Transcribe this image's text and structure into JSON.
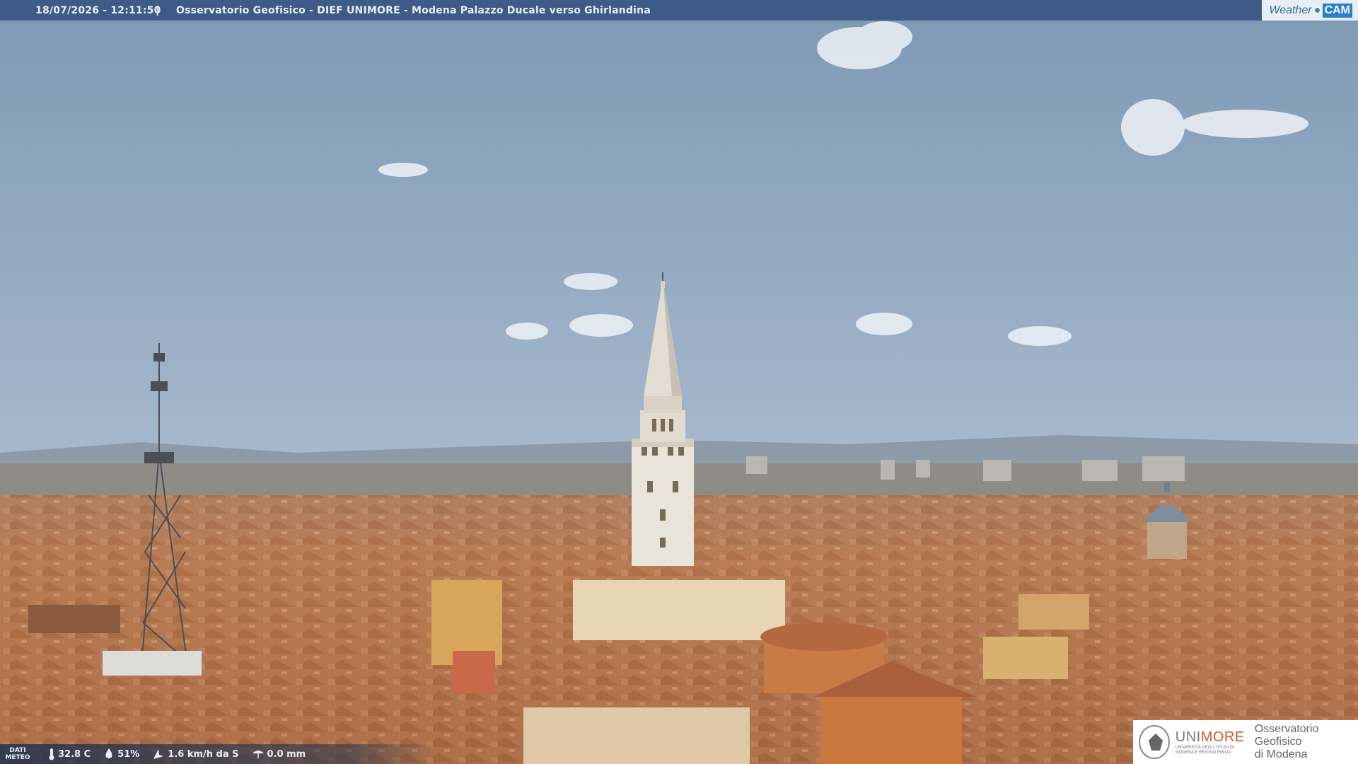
{
  "overlay": {
    "timestamp": "18/07/2026 - 12:11:50",
    "separator": "|",
    "title": "Osservatorio Geofisico - DIEF UNIMORE - Modena Palazzo Ducale verso Ghirlandina"
  },
  "logo": {
    "weather": "Weather",
    "cam": "CAM"
  },
  "meteo": {
    "label_line1": "DATI",
    "label_line2": "METEO",
    "temperature": "32.8 C",
    "humidity": "51%",
    "wind": "1.6 km/h da S",
    "rain": "0.0 mm",
    "icons": [
      "thermometer-icon",
      "humidity-drop-icon",
      "wind-icon",
      "rain-icon"
    ]
  },
  "institution": {
    "brand_uni": "UNI",
    "brand_more": "MORE",
    "brand_small_line1": "UNIVERSITÀ DEGLI STUDI DI",
    "brand_small_line2": "MODENA E REGGIO EMILIA",
    "name_line1": "Osservatorio Geofisico",
    "name_line2": "di Modena"
  },
  "colors": {
    "sky_top": "#7f9ab6",
    "sky_bottom": "#c3d0dc",
    "roofs": "#b5744d",
    "tower": "#e6e0d6",
    "topbar": "#3d5b86"
  }
}
